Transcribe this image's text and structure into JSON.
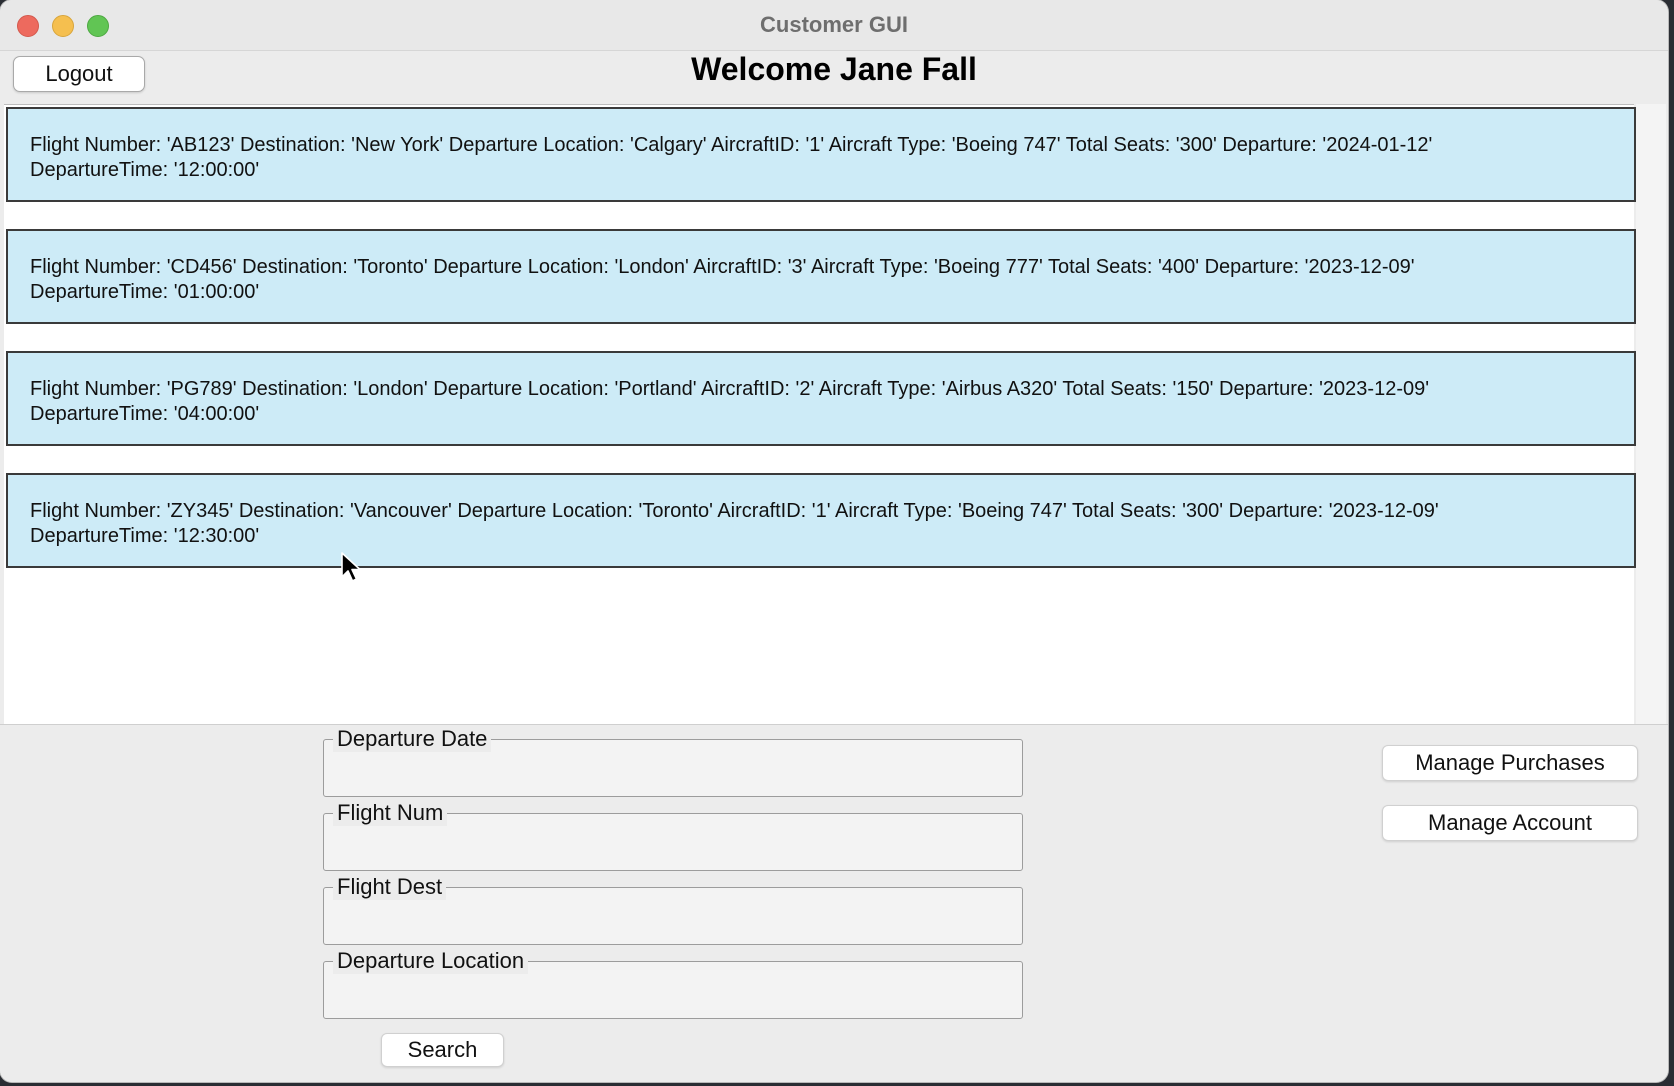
{
  "window": {
    "title": "Customer GUI"
  },
  "header": {
    "logout_label": "Logout",
    "welcome_text": "Welcome Jane Fall"
  },
  "flights": [
    {
      "line1": "Flight Number: 'AB123' Destination: 'New York' Departure Location: 'Calgary' AircraftID: '1' Aircraft Type: 'Boeing 747' Total Seats: '300' Departure: '2024-01-12'",
      "line2": "DepartureTime: '12:00:00'"
    },
    {
      "line1": "Flight Number: 'CD456' Destination: 'Toronto' Departure Location: 'London' AircraftID: '3' Aircraft Type: 'Boeing 777' Total Seats: '400' Departure: '2023-12-09'",
      "line2": "DepartureTime: '01:00:00'"
    },
    {
      "line1": "Flight Number: 'PG789' Destination: 'London' Departure Location: 'Portland' AircraftID: '2' Aircraft Type: 'Airbus A320' Total Seats: '150' Departure: '2023-12-09'",
      "line2": "DepartureTime: '04:00:00'"
    },
    {
      "line1": "Flight Number: 'ZY345' Destination: 'Vancouver' Departure Location: 'Toronto' AircraftID: '1' Aircraft Type: 'Boeing 747' Total Seats: '300' Departure: '2023-12-09'",
      "line2": "DepartureTime: '12:30:00'"
    }
  ],
  "search": {
    "fields": [
      {
        "label": "Departure Date",
        "value": ""
      },
      {
        "label": "Flight Num",
        "value": ""
      },
      {
        "label": "Flight Dest",
        "value": ""
      },
      {
        "label": "Departure Location",
        "value": ""
      }
    ],
    "search_label": "Search"
  },
  "actions": {
    "manage_purchases_label": "Manage Purchases",
    "manage_account_label": "Manage Account"
  },
  "icons": {
    "cursor": "mouse-pointer-icon"
  },
  "colors": {
    "card_bg": "#cdebf7",
    "card_border": "#3a3a3a",
    "window_bg": "#ececec"
  }
}
